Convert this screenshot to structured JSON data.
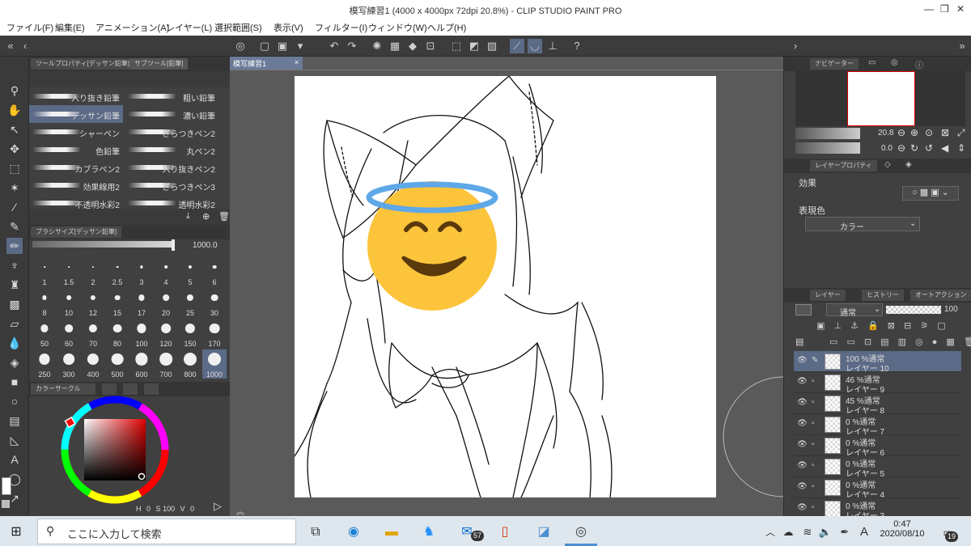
{
  "window": {
    "title": "模写練習1 (4000 x 4000px 72dpi 20.8%)  - CLIP STUDIO PAINT PRO"
  },
  "menu": [
    "ファイル(F)",
    "編集(E)",
    "アニメーション(A)",
    "レイヤー(L)",
    "選択範囲(S)",
    "表示(V)",
    "フィルター(I)",
    "ウィンドウ(W)",
    "ヘルプ(H)"
  ],
  "panels": {
    "tool_property_tab": "ツールプロパティ[デッサン鉛筆]",
    "subtool_tab": "サブツール[鉛筆]",
    "brush_size_header": "ブラシサイズ[デッサン鉛筆]",
    "brush_size_value": "1000.0",
    "color_circle_tab": "カラーサークル",
    "color_status": {
      "h_label": "H",
      "h": "0",
      "s_label": "S",
      "s": "100",
      "v_label": "V",
      "v": "0"
    }
  },
  "subtools": [
    {
      "left": "入り抜き鉛筆",
      "right": "粗い鉛筆"
    },
    {
      "left": "デッサン鉛筆",
      "right": "濃い鉛筆"
    },
    {
      "left": "シャーペン",
      "right": "ざらつきペン2"
    },
    {
      "left": "色鉛筆",
      "right": "丸ペン2"
    },
    {
      "left": "カブラペン2",
      "right": "入り抜きペン2"
    },
    {
      "left": "効果線用2",
      "right": "ざらつきペン3"
    },
    {
      "left": "不透明水彩2",
      "right": "透明水彩2"
    }
  ],
  "brush_sizes": [
    "1",
    "1.5",
    "2",
    "2.5",
    "3",
    "4",
    "5",
    "6",
    "8",
    "10",
    "12",
    "15",
    "17",
    "20",
    "25",
    "30",
    "50",
    "60",
    "70",
    "80",
    "100",
    "120",
    "150",
    "170",
    "250",
    "300",
    "400",
    "500",
    "600",
    "700",
    "800",
    "1000"
  ],
  "document_tab": "模写練習1",
  "navigator": {
    "tab": "ナビゲーター",
    "zoom": "20.8",
    "rotation": "0.0"
  },
  "layer_property": {
    "tab": "レイヤープロパティ",
    "effect_label": "効果",
    "expression_label": "表現色",
    "expression_value": "カラー"
  },
  "layers_panel": {
    "tab_layer": "レイヤー",
    "tab_history": "ヒストリー",
    "tab_autoaction": "オートアクション",
    "blend_mode": "通常",
    "opacity": "100",
    "layers": [
      {
        "opacity_mode": "100 %通常",
        "name": "レイヤー 10"
      },
      {
        "opacity_mode": "46 %通常",
        "name": "レイヤー 9"
      },
      {
        "opacity_mode": "45 %通常",
        "name": "レイヤー 8"
      },
      {
        "opacity_mode": "0 %通常",
        "name": "レイヤー 7"
      },
      {
        "opacity_mode": "0 %通常",
        "name": "レイヤー 6"
      },
      {
        "opacity_mode": "0 %通常",
        "name": "レイヤー 5"
      },
      {
        "opacity_mode": "0 %通常",
        "name": "レイヤー 4"
      },
      {
        "opacity_mode": "0 %通常",
        "name": "レイヤー 3"
      }
    ]
  },
  "taskbar": {
    "search_placeholder": "ここに入力して検索",
    "mail_badge": "57",
    "time": "0:47",
    "date": "2020/08/10",
    "notification_badge": "19",
    "ime": "A"
  },
  "colors": {
    "accent": "#5b6a86",
    "panel_bg": "#404040",
    "taskbar_bg": "#dfe7ee"
  }
}
